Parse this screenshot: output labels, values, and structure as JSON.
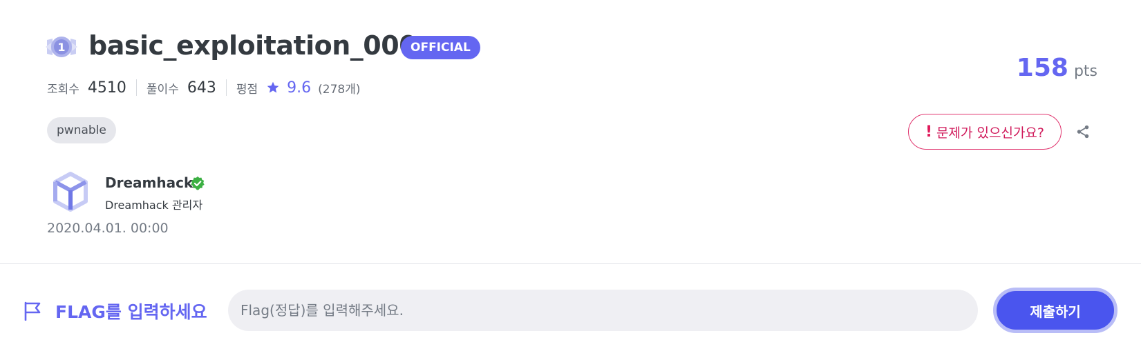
{
  "challenge": {
    "level": "1",
    "title": "basic_exploitation_000",
    "badge": "OFFICIAL",
    "stats": {
      "views_label": "조회수",
      "views": "4510",
      "solves_label": "풀이수",
      "solves": "643",
      "rating_label": "평점",
      "rating": "9.6",
      "rating_count": "(278개)"
    },
    "tags": [
      "pwnable"
    ],
    "author": {
      "name": "Dreamhack",
      "role": "Dreamhack 관리자"
    },
    "date": "2020.04.01. 00:00",
    "points": "158",
    "points_unit": "pts",
    "report_button": "문제가 있으신가요?",
    "report_mark": "!"
  },
  "flag": {
    "label": "FLAG를 입력하세요",
    "placeholder": "Flag(정답)를 입력해주세요.",
    "value": "",
    "submit_label": "제출하기"
  },
  "icons": {
    "level": "level-1-badge-icon",
    "star": "star-icon",
    "verified": "verified-check-icon",
    "share": "share-icon",
    "flag": "flag-icon",
    "avatar": "dreamhack-logo"
  },
  "colors": {
    "accent": "#6466f1",
    "submit": "#4a55ee",
    "report": "#e0336d",
    "verified": "#3cb043"
  }
}
